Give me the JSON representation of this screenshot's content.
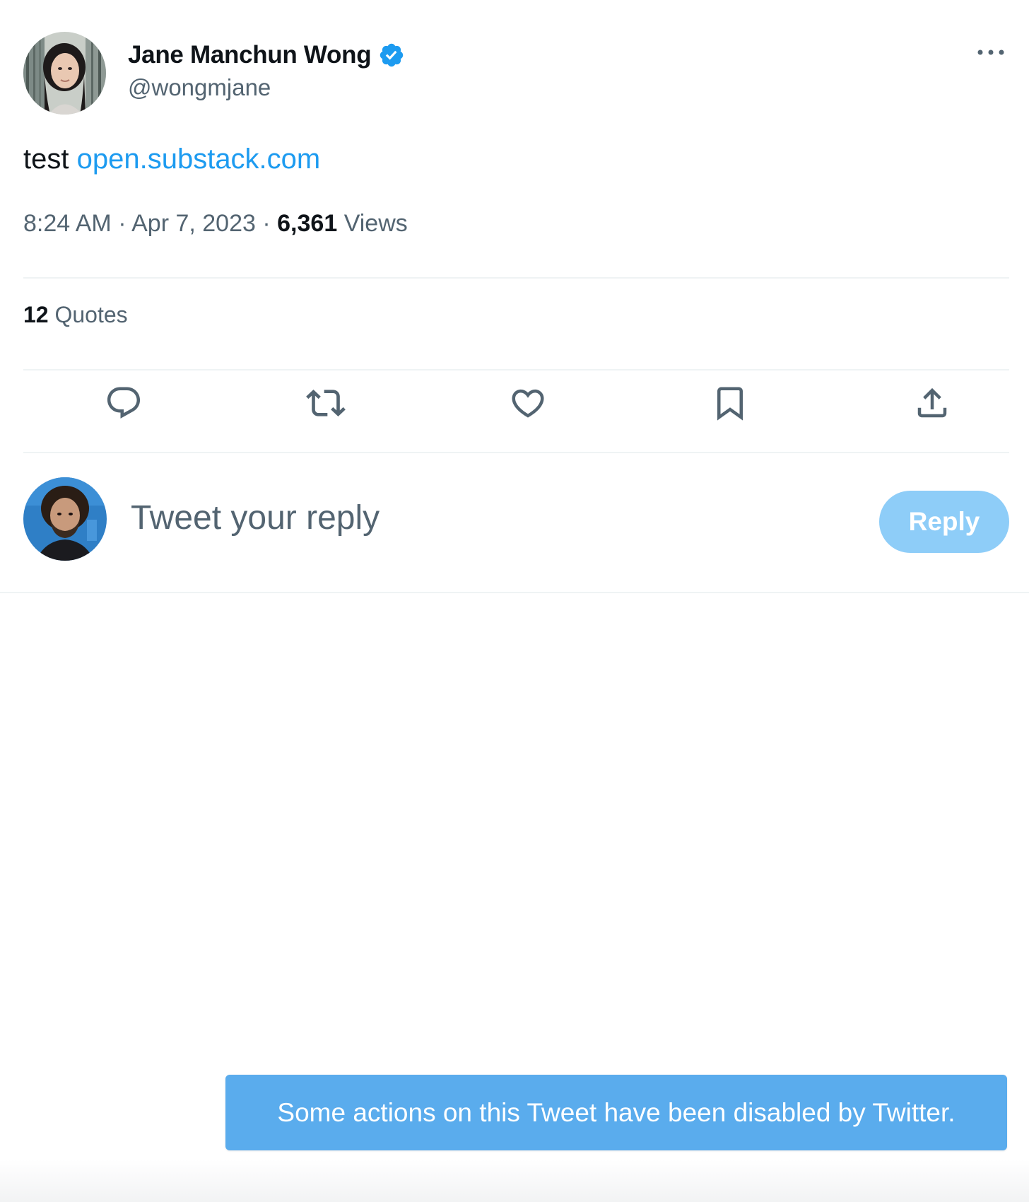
{
  "tweet": {
    "author": {
      "display_name": "Jane Manchun Wong",
      "handle": "@wongmjane",
      "verified": true,
      "verified_color": "#1d9bf0"
    },
    "text": "test",
    "link": "open.substack.com",
    "meta": {
      "time": "8:24 AM",
      "separator": "·",
      "date": "Apr 7, 2023",
      "views_count": "6,361",
      "views_label": "Views"
    },
    "quotes": {
      "count": "12",
      "label": "Quotes"
    },
    "actions": [
      "reply-icon",
      "retweet-icon",
      "like-icon",
      "bookmark-icon",
      "share-icon"
    ]
  },
  "reply_composer": {
    "placeholder": "Tweet your reply",
    "button_label": "Reply",
    "button_color": "#8ecdf8"
  },
  "toast": {
    "message": "Some actions on this Tweet have been disabled by Twitter.",
    "color": "#5aaced"
  },
  "colors": {
    "text_primary": "#0f1419",
    "text_secondary": "#536471",
    "link": "#1d9bf0",
    "divider": "#eff3f4"
  }
}
